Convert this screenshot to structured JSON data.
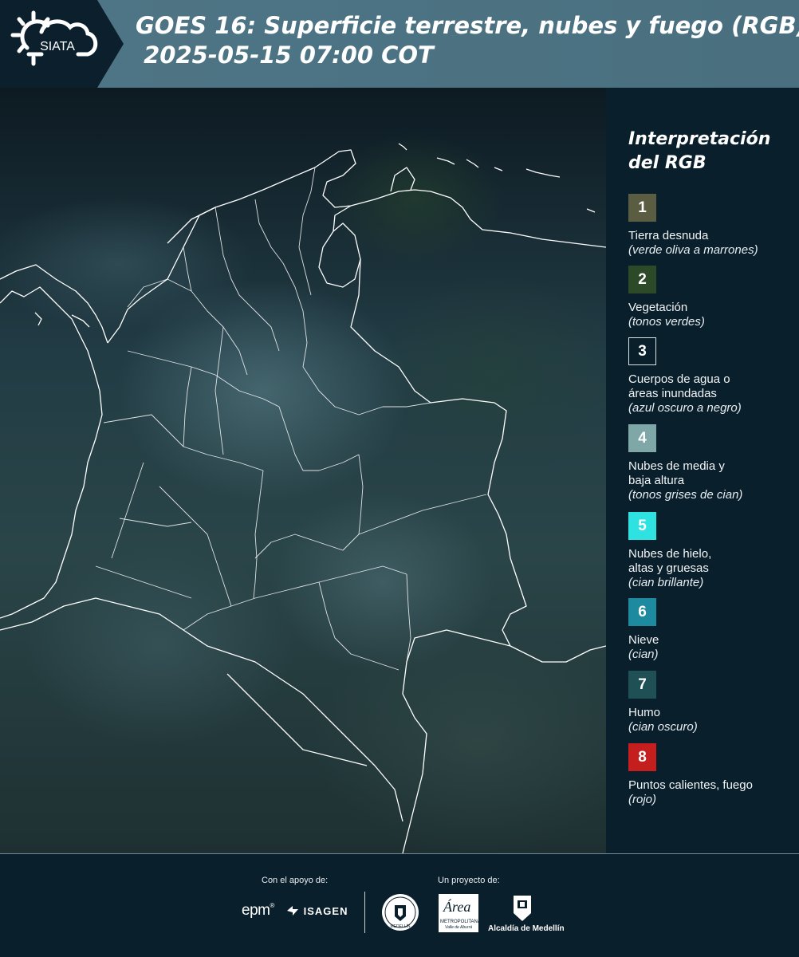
{
  "header": {
    "logo_text": "SIATA",
    "title_line1": "GOES 16: Superficie terrestre, nubes y fuego (RGB)",
    "title_line2": " 2025-05-15 07:00 COT"
  },
  "map": {
    "image_description_icon": "satellite-map"
  },
  "legend": {
    "title_line1": "Interpretación",
    "title_line2": "del RGB",
    "items": [
      {
        "number": "1",
        "color": "#5a5d42",
        "name": "Tierra desnuda",
        "desc": "(verde oliva a marrones)"
      },
      {
        "number": "2",
        "color": "#2d4a28",
        "name": "Vegetación",
        "desc": "(tonos verdes)"
      },
      {
        "number": "3",
        "color": "#0a1f2c",
        "name": "Cuerpos de agua o\náreas inundadas",
        "desc": "(azul oscuro a negro)"
      },
      {
        "number": "4",
        "color": "#7fa7a8",
        "name": "Nubes de media y\nbaja altura",
        "desc": "(tonos grises de cian)"
      },
      {
        "number": "5",
        "color": "#2ee2e2",
        "name": "Nubes de hielo,\naltas y gruesas",
        "desc": "(cian brillante)"
      },
      {
        "number": "6",
        "color": "#1d8aa0",
        "name": "Nieve",
        "desc": "(cian)"
      },
      {
        "number": "7",
        "color": "#1f5055",
        "name": "Humo",
        "desc": "(cian oscuro)"
      },
      {
        "number": "8",
        "color": "#c41e1e",
        "name": "Puntos calientes, fuego",
        "desc": "(rojo)"
      }
    ]
  },
  "footer": {
    "support_label": "Con el apoyo de:",
    "project_label": "Un proyecto de:",
    "sponsors": {
      "epm": "epm",
      "isagen": "ISAGEN",
      "area_main": "Área",
      "area_sub": "METROPOLITANA",
      "area_sub2": "Valle de Aburrá",
      "medellin_uni": "MEDELLÍN",
      "alcaldia": "Alcaldía de Medellín"
    }
  }
}
